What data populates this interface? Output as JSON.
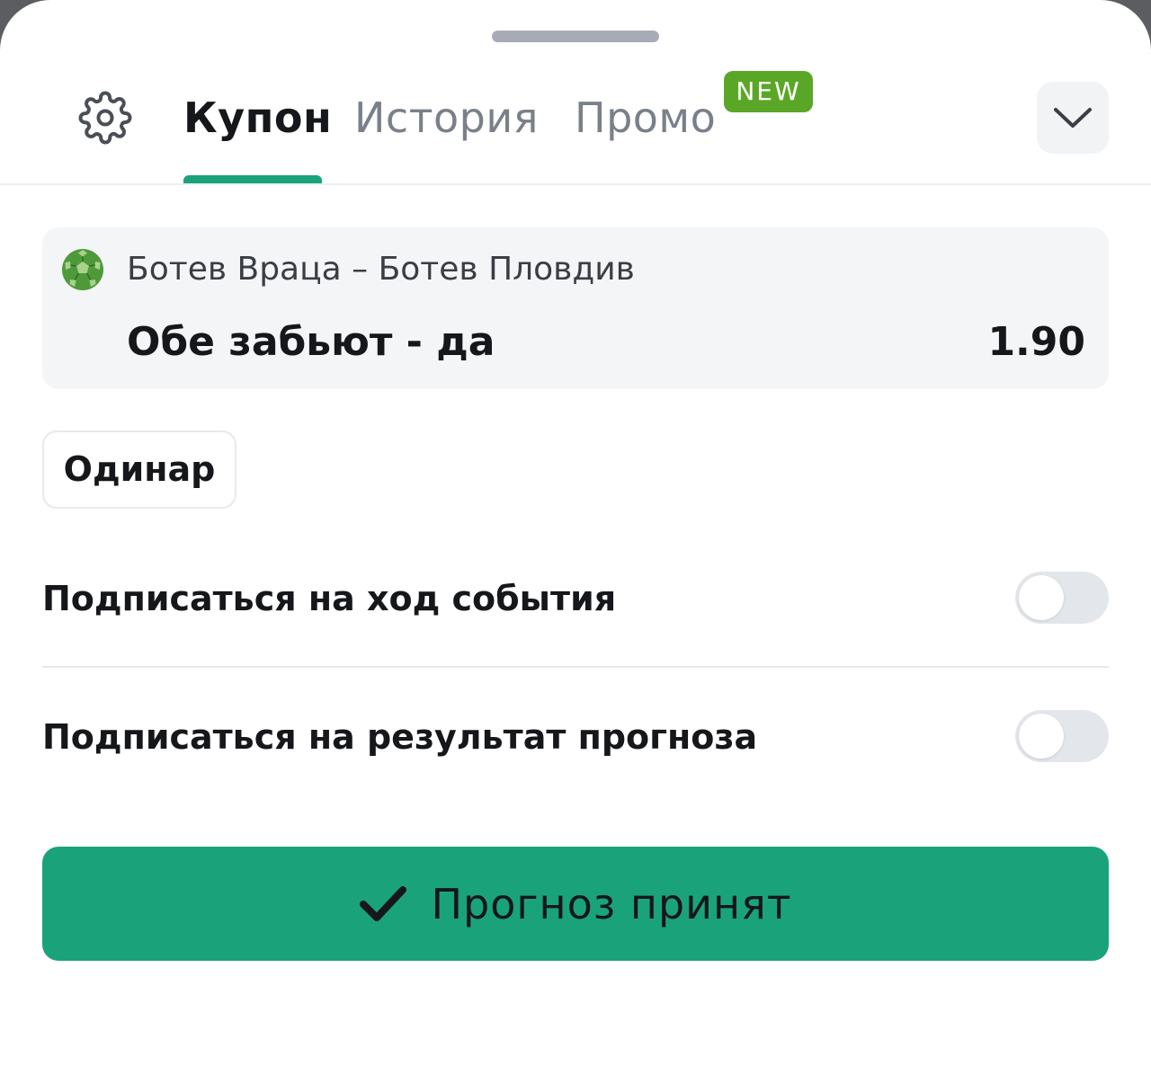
{
  "header": {
    "tabs": [
      {
        "label": "Купон",
        "active": true
      },
      {
        "label": "История",
        "active": false
      },
      {
        "label": "Промо",
        "active": false,
        "badge": "NEW"
      }
    ],
    "settings_icon": "gear-icon",
    "collapse_icon": "chevron-down-icon"
  },
  "bet": {
    "sport_icon": "soccer-ball-icon",
    "event": "Ботев Враца – Ботев Пловдив",
    "outcome": "Обе забьют - да",
    "odds": "1.90"
  },
  "bet_type": "Одинар",
  "subscriptions": [
    {
      "label": "Подписаться на ход события",
      "enabled": false
    },
    {
      "label": "Подписаться на результат прогноза",
      "enabled": false
    }
  ],
  "submit": {
    "icon": "checkmark-icon",
    "label": "Прогноз принят"
  },
  "colors": {
    "accent": "#1aa37a",
    "badge": "#5aa727",
    "card_bg": "#f3f5f6",
    "text": "#15171b",
    "muted": "#7a8089"
  }
}
